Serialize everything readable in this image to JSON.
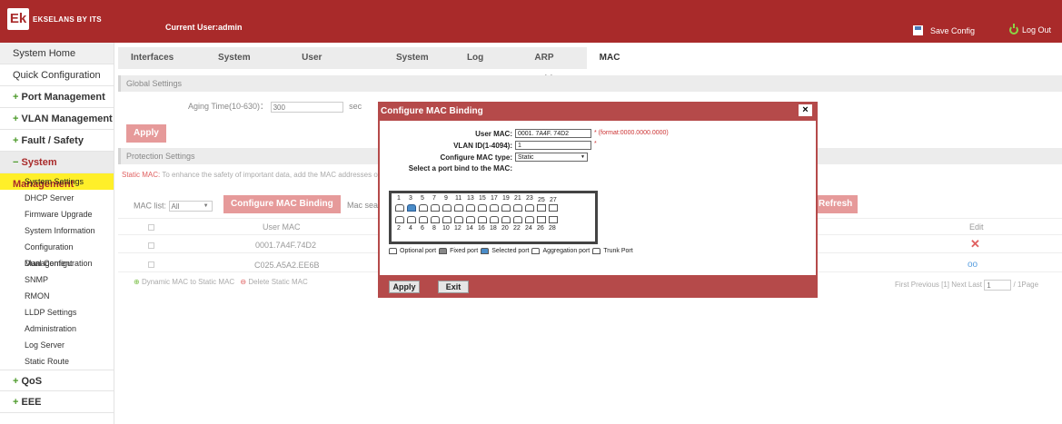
{
  "header": {
    "logo_mark": "Ek",
    "logo_text": "EKSELANS BY ITS",
    "current_user": "Current User:admin",
    "save_label": "Save Config",
    "logout_label": "Log Out"
  },
  "sidebar": {
    "items": [
      {
        "label": "System Home"
      },
      {
        "label": "Quick Configuration"
      },
      {
        "label": "Port Management"
      },
      {
        "label": "VLAN Management"
      },
      {
        "label": "Fault / Safety"
      },
      {
        "label": "System Management"
      },
      {
        "label": "QoS"
      },
      {
        "label": "EEE"
      }
    ],
    "sub_items": [
      "System Settings",
      "DHCP Server",
      "Firmware Upgrade",
      "System Information",
      "Configuration Management",
      "Dual Configuration",
      "SNMP",
      "RMON",
      "LLDP Settings",
      "Administration",
      "Log Server",
      "Static Route"
    ]
  },
  "tabs": [
    "Interfaces VLAN",
    "System Restart",
    "User Management",
    "System Log",
    "Log Export",
    "ARP Table",
    "MAC Management"
  ],
  "global": {
    "title": "Global Settings",
    "aging_label": "Aging Time(10-630)：",
    "aging_value": "300",
    "aging_unit": "sec",
    "apply": "Apply"
  },
  "protection": {
    "title": "Protection Settings",
    "note_prefix": "Static MAC:",
    "note_text": "To enhance the safety of important data, add the MAC addresses of th"
  },
  "mac_list": {
    "label": "MAC list:",
    "select": "All",
    "configure_btn": "Configure MAC Binding",
    "search_label": "Mac searc",
    "refresh_btn": "Refresh",
    "col_user_mac": "User MAC",
    "col_edit": "Edit",
    "rows": [
      "0001.7A4F.74D2",
      "C025.A5A2.EE6B"
    ],
    "dynamic_to_static": "Dynamic MAC to Static MAC",
    "delete_static": "Delete Static MAC",
    "pager": "First  Previous [1]  Next  Last",
    "pager_input": "1",
    "pager_total": "/ 1Page"
  },
  "modal": {
    "title": "Configure MAC Binding",
    "close": "×",
    "user_mac_label": "User MAC:",
    "user_mac_value": "0001. 7A4F. 74D2",
    "user_mac_hint": "* (format:0000.0000.0000)",
    "vlan_label": "VLAN ID(1-4094):",
    "vlan_value": "1",
    "vlan_hint": "*",
    "type_label": "Configure MAC type:",
    "type_value": "Static",
    "port_label": "Select a port bind to the MAC:",
    "top_numbers": [
      "1",
      "3",
      "5",
      "7",
      "9",
      "11",
      "13",
      "15",
      "17",
      "19",
      "21",
      "23",
      "25",
      "27"
    ],
    "bottom_numbers": [
      "2",
      "4",
      "6",
      "8",
      "10",
      "12",
      "14",
      "16",
      "18",
      "20",
      "22",
      "24",
      "26",
      "28"
    ],
    "legend": [
      "Optional port",
      "Fixed port",
      "Selected port",
      "Aggregation port",
      "Trunk Port"
    ],
    "apply": "Apply",
    "exit": "Exit"
  }
}
